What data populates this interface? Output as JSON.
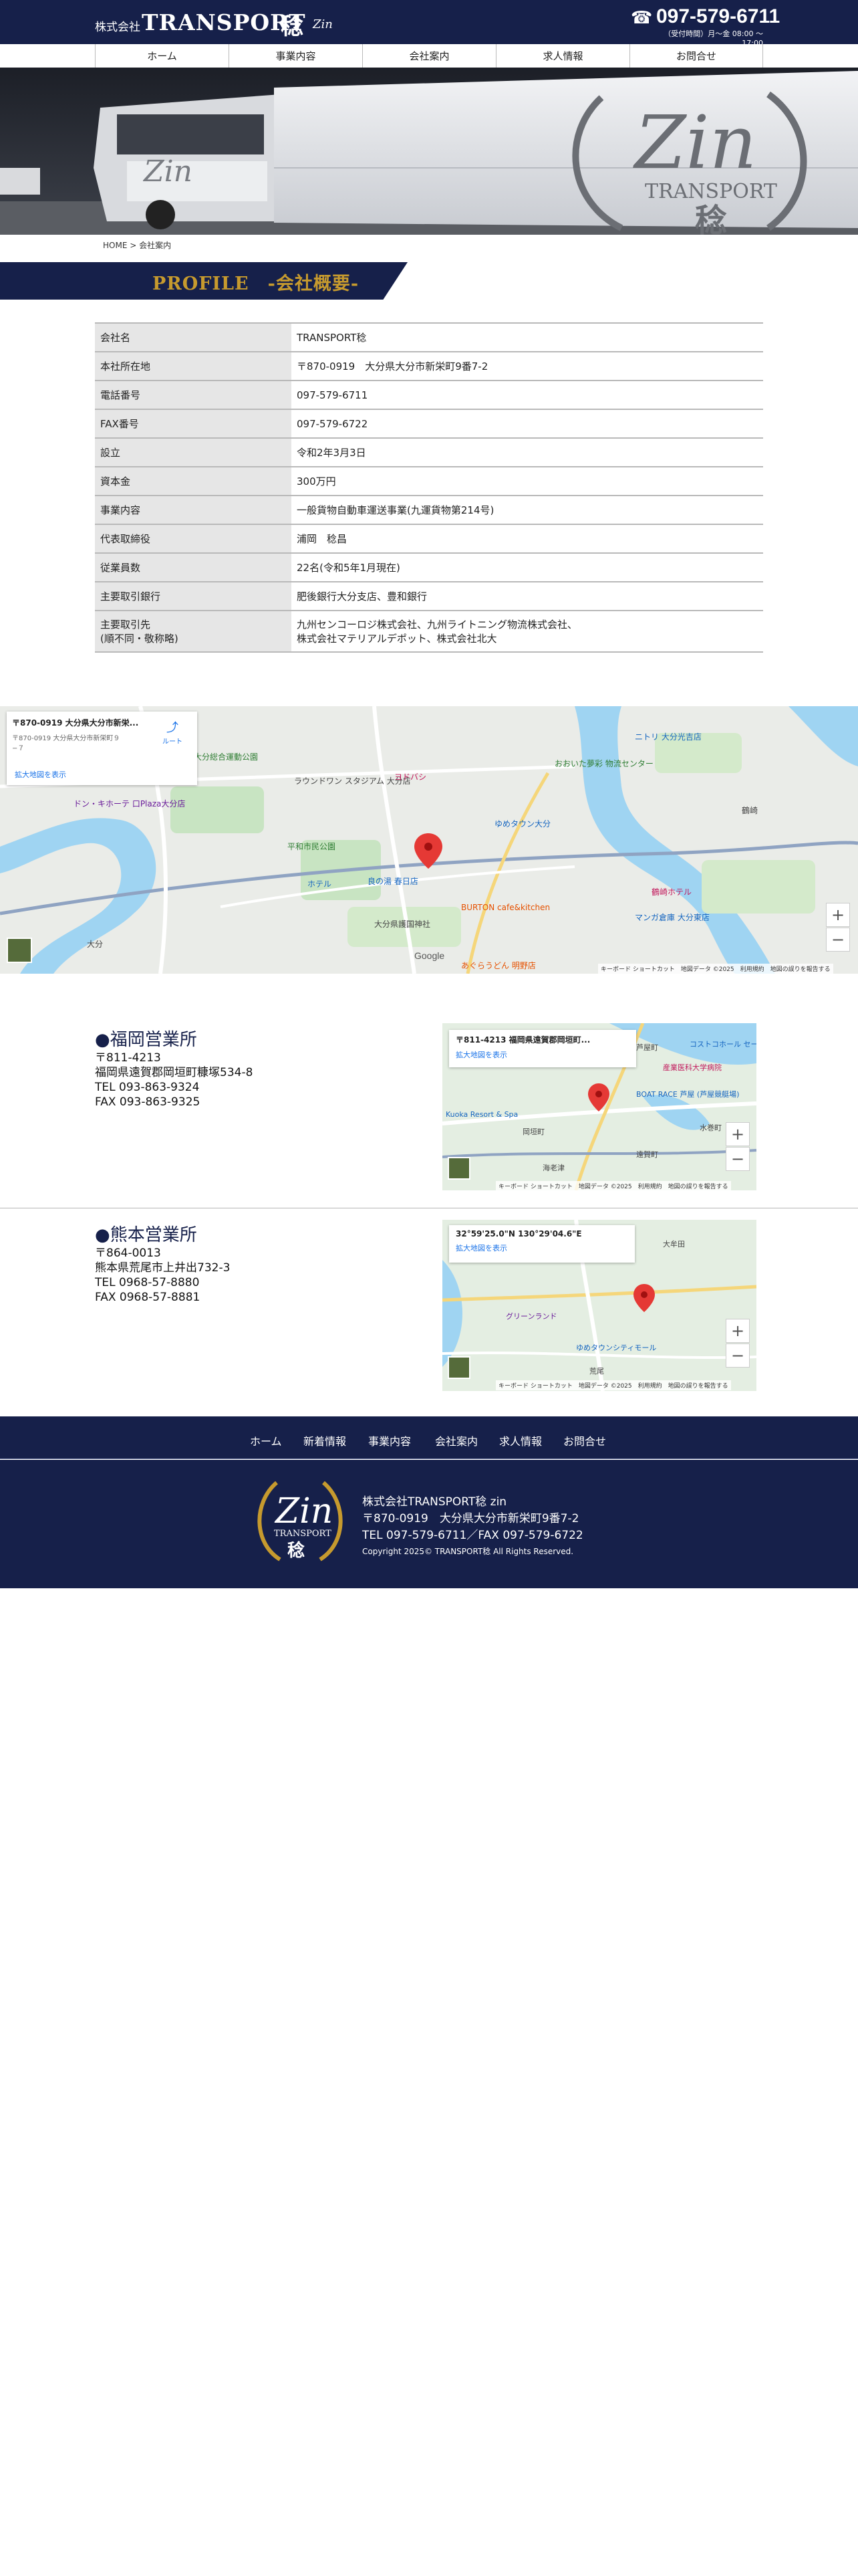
{
  "header": {
    "logo_small": "株式会社",
    "logo_big": "TRANSPORT",
    "logo_kanji": "稔",
    "logo_zin": "Zin",
    "phone": "097-579-6711",
    "phone_hours": "（受付時間）月〜金 08:00 〜 17:00"
  },
  "nav": {
    "items": [
      "ホーム",
      "事業内容",
      "会社案内",
      "求人情報",
      "お問合せ"
    ]
  },
  "hero": {
    "truck_logo_zin": "Zin",
    "truck_logo_transport": "TRANSPORT",
    "truck_logo_kanji": "稔"
  },
  "breadcrumb": {
    "home": "HOME",
    "separator": ">",
    "current": "会社案内"
  },
  "profile": {
    "title": "PROFILE　-会社概要-"
  },
  "company_table": [
    {
      "label": "会社名",
      "value": "TRANSPORT稔"
    },
    {
      "label": "本社所在地",
      "value": "〒870-0919　大分県大分市新栄町9番7-2"
    },
    {
      "label": "電話番号",
      "value": "097-579-6711"
    },
    {
      "label": "FAX番号",
      "value": "097-579-6722"
    },
    {
      "label": "設立",
      "value": "令和2年3月3日"
    },
    {
      "label": "資本金",
      "value": "300万円"
    },
    {
      "label": "事業内容",
      "value": "一般貨物自動車運送事業(九運貨物第214号)"
    },
    {
      "label": "代表取締役",
      "value": "浦岡　稔昌"
    },
    {
      "label": "従業員数",
      "value": "22名(令和5年1月現在)"
    },
    {
      "label": "主要取引銀行",
      "value": "肥後銀行大分支店、豊和銀行"
    },
    {
      "label": "主要取引先\n(順不同・敬称略)",
      "value": "九州センコーロジ株式会社、九州ライトニング物流株式会社、\n株式会社マテリアルデポット、株式会社北大"
    }
  ],
  "map_main": {
    "address": "〒870-0919 大分県大分市新栄...",
    "sub_address": "〒870-0919 大分県大分市新栄町９\n−７",
    "route": "ルート",
    "enlarge": "拡大地図を表示",
    "labels": [
      "大分総合運動公園",
      "ラウンドワン\nスタジアム 大分店",
      "ドン・キホーテ\n口Plaza大分店",
      "ヨドバシ",
      "平和市民公園",
      "良の湯 春日店",
      "大分県護国神社",
      "BURTON cafe&kitchen",
      "ゆめタウン大分",
      "あぐらうどん 明野店",
      "ホテル",
      "大分",
      "おおいた夢彩\n物流センター",
      "ニトリ 大分光吉店",
      "マンガ倉庫 大分東店",
      "鶴崎",
      "鶴崎ホテル",
      "Google"
    ],
    "footer": "キーボード ショートカット　地図データ ©2025　利用規約　地図の誤りを報告する"
  },
  "offices": [
    {
      "name": "福岡営業所",
      "postal": "〒811-4213",
      "address": "福岡県遠賀郡岡垣町糠塚534-8",
      "tel": "TEL 093-863-9324",
      "fax": "FAX 093-863-9325",
      "map_title": "〒811-4213 福岡県遠賀郡岡垣町...",
      "map_link": "拡大地図を表示",
      "map_labels": [
        "芦屋町",
        "コストコホール\nセール 北九州倉庫店",
        "産業医科大学病院",
        "BOAT RACE 芦屋\n(芦屋競艇場)",
        "水巻町",
        "遠賀町",
        "岡垣町",
        "Kuoka\nResort & Spa",
        "海老津"
      ],
      "map_footer": "キーボード ショートカット　地図データ ©2025　利用規約　地図の誤りを報告する"
    },
    {
      "name": "熊本営業所",
      "postal": "〒864-0013",
      "address": "熊本県荒尾市上井出732-3",
      "tel": "TEL 0968-57-8880",
      "fax": "FAX 0968-57-8881",
      "map_title": "32°59'25.0\"N 130°29'04.6\"E",
      "map_link": "拡大地図を表示",
      "map_labels": [
        "グリーンランド",
        "ゆめタウンシティモール",
        "荒尾",
        "大牟田"
      ],
      "map_footer": "キーボード ショートカット　地図データ ©2025　利用規約　地図の誤りを報告する"
    }
  ],
  "footer_nav": {
    "items": [
      "ホーム",
      "新着情報",
      "事業内容",
      "会社案内",
      "求人情報",
      "お問合せ"
    ]
  },
  "footer": {
    "emblem_zin": "Zin",
    "emblem_transport": "TRANSPORT",
    "emblem_kanji": "稔",
    "company": "株式会社TRANSPORT稔 zin",
    "address": "〒870-0919　大分県大分市新栄町9番7-2",
    "telfax": "TEL 097-579-6711／FAX 097-579-6722",
    "copyright": "Copyright 2025© TRANSPORT稔 All Rights Reserved."
  },
  "colors": {
    "navy": "#16204a",
    "gold": "#c69a2e",
    "table_header_bg": "#e6e6e6",
    "map_water": "#9fd4f2",
    "map_pin": "#e53935"
  }
}
